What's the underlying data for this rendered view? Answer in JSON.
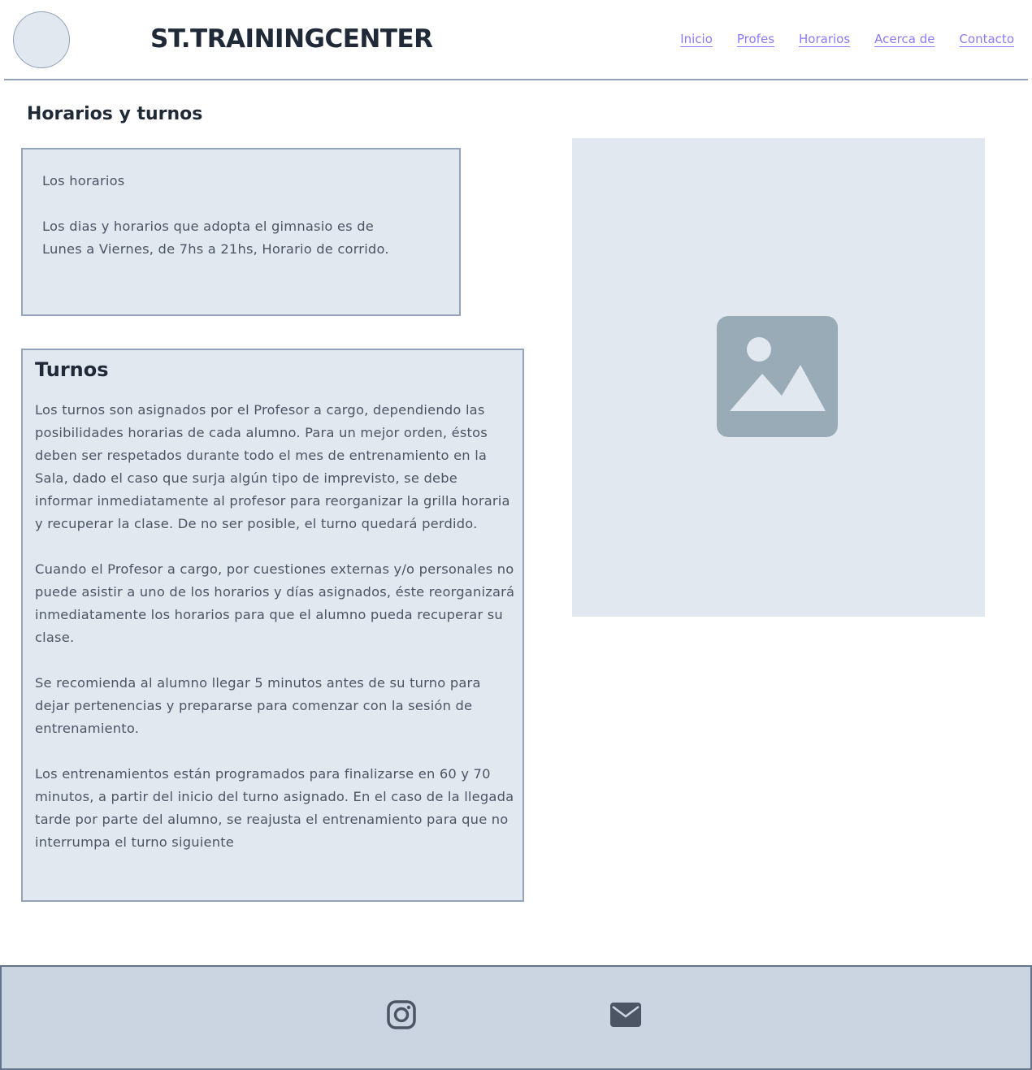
{
  "header": {
    "brand": "ST.TRAININGCENTER",
    "nav": [
      {
        "label": "Inicio"
      },
      {
        "label": "Profes"
      },
      {
        "label": "Horarios"
      },
      {
        "label": "Acerca de"
      },
      {
        "label": "Contacto"
      }
    ]
  },
  "main": {
    "page_title": "Horarios y turnos",
    "horarios": {
      "text": "Los horarios\n\nLos dias y horarios que adopta el gimnasio es de Lunes a Viernes, de 7hs a 21hs, Horario de corrido."
    },
    "turnos": {
      "title": "Turnos",
      "text": "Los turnos son asignados por el Profesor a cargo, dependiendo las posibilidades horarias de cada alumno. Para un mejor orden, éstos deben ser respetados durante todo el mes de entrenamiento en la Sala, dado el caso que surja algún tipo de imprevisto, se debe informar inmediatamente al profesor para reorganizar la grilla horaria y recuperar la clase. De no ser posible, el turno quedará perdido.\n\nCuando el Profesor a cargo, por cuestiones externas y/o personales no puede asistir a uno de los horarios y días asignados, éste reorganizará inmediatamente los horarios para que el alumno pueda recuperar su clase.\n\nSe recomienda al alumno llegar 5 minutos antes de su turno para dejar pertenencias y prepararse para comenzar con la sesión de entrenamiento.\n\nLos entrenamientos están programados para finalizarse en 60 y 70 minutos, a partir del inicio del turno asignado. En el caso de la llegada tarde por parte del alumno, se reajusta el entrenamiento para que no interrumpa el turno siguiente"
    },
    "image_icon": "image-placeholder-icon"
  },
  "footer": {
    "icons": [
      "instagram-icon",
      "mail-icon"
    ]
  },
  "colors": {
    "nav_link": "#8b7cf6",
    "panel": "#e2e8f0",
    "border": "#94a3b8",
    "footer": "#cbd5e1",
    "heading": "#1f2937"
  }
}
